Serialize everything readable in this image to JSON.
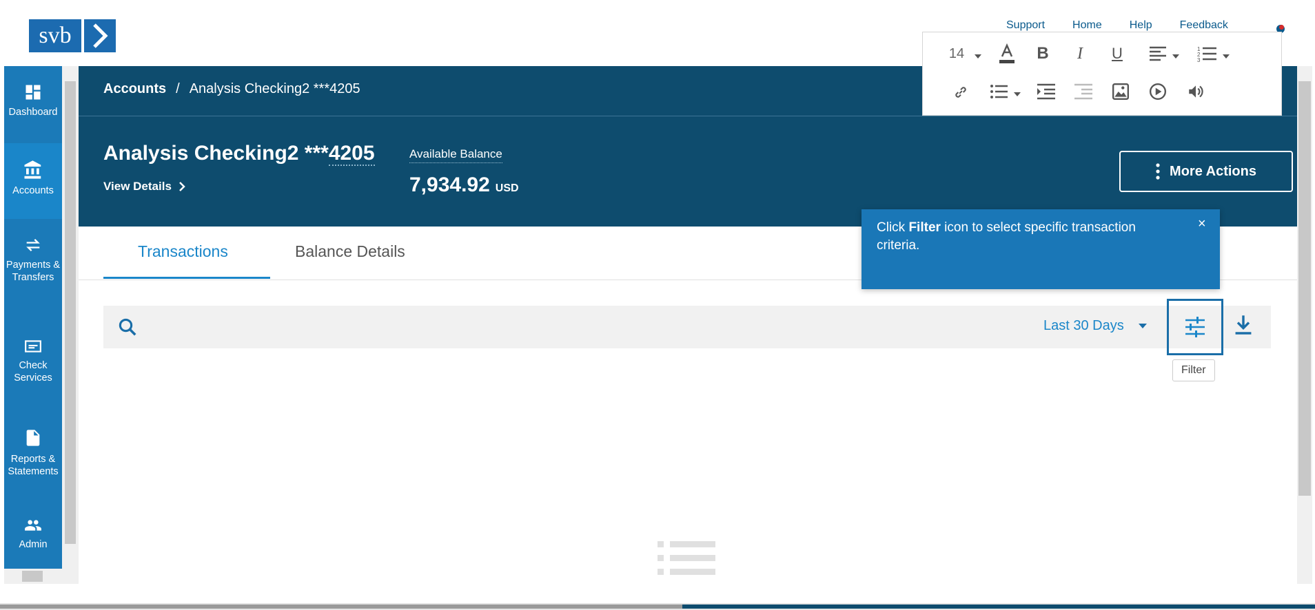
{
  "logo": {
    "text": "svb"
  },
  "header_nav": [
    "Support",
    "Home",
    "Help",
    "Feedback"
  ],
  "sidebar": {
    "items": [
      {
        "label": "Dashboard",
        "icon": "dashboard-icon"
      },
      {
        "label": "Accounts",
        "icon": "bank-icon"
      },
      {
        "label": "Payments & Transfers",
        "icon": "transfer-icon"
      },
      {
        "label": "Check Services",
        "icon": "check-icon"
      },
      {
        "label": "Reports & Statements",
        "icon": "document-icon"
      },
      {
        "label": "Admin",
        "icon": "people-icon"
      }
    ],
    "active_index": 1
  },
  "breadcrumb": {
    "root": "Accounts",
    "separator": "/",
    "current": "Analysis Checking2 ***4205"
  },
  "account": {
    "title_prefix": "Analysis Checking2 ***",
    "title_suffix": "4205",
    "view_details": "View Details",
    "available_label": "Available Balance",
    "balance": "7,934.92",
    "currency": "USD"
  },
  "more_actions": {
    "label": "More Actions"
  },
  "editor": {
    "font_size": "14"
  },
  "tabs": [
    {
      "label": "Transactions",
      "active": true
    },
    {
      "label": "Balance Details",
      "active": false
    }
  ],
  "toolbar": {
    "period": "Last 30 Days",
    "filter_tooltip": "Filter"
  },
  "callout": {
    "text_before": "Click ",
    "text_bold": "Filter",
    "text_after": " icon to select specific transaction criteria.",
    "close": "×"
  },
  "colors": {
    "brand_dark": "#0e4c6e",
    "accent": "#1a86c9",
    "sidebar": "#1b7ab8"
  }
}
